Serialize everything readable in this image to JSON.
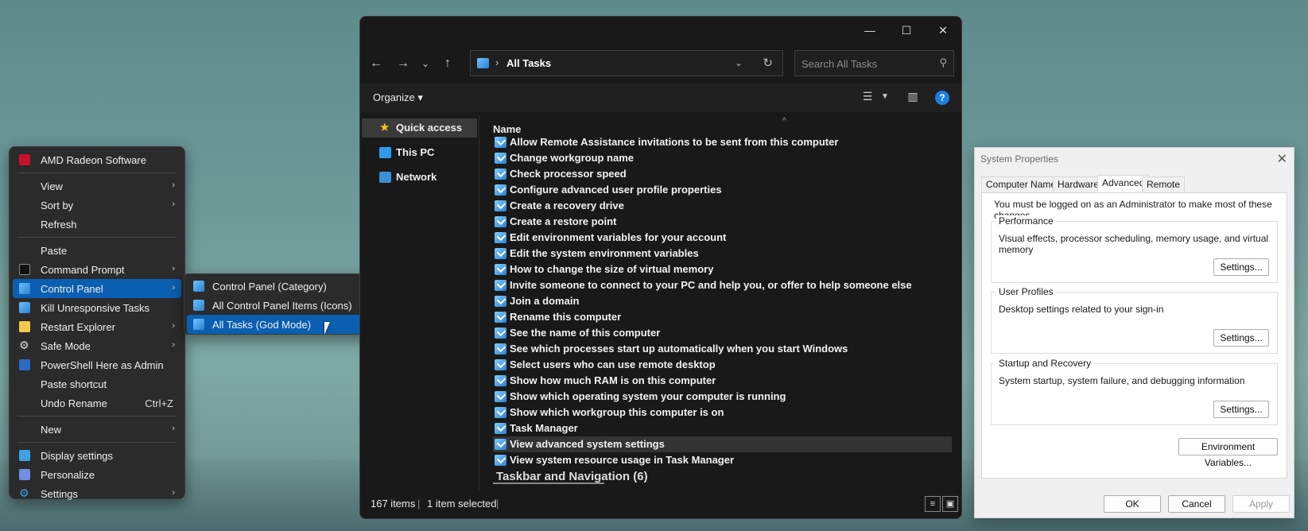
{
  "context_menu": {
    "items": [
      {
        "label": "AMD Radeon Software",
        "icon": "amd-radeon-icon"
      },
      {
        "label": "View",
        "submenu": true
      },
      {
        "label": "Sort by",
        "submenu": true
      },
      {
        "label": "Refresh"
      },
      {
        "label": "Paste"
      },
      {
        "label": "Command Prompt",
        "submenu": true,
        "icon": "command-prompt-icon"
      },
      {
        "label": "Control Panel",
        "submenu": true,
        "icon": "control-panel-icon"
      },
      {
        "label": "Kill Unresponsive Tasks",
        "icon": "kill-tasks-icon"
      },
      {
        "label": "Restart Explorer",
        "submenu": true,
        "icon": "folder-icon"
      },
      {
        "label": "Safe Mode",
        "submenu": true,
        "icon": "gear-icon"
      },
      {
        "label": "PowerShell Here as Admin",
        "icon": "powershell-icon"
      },
      {
        "label": "Paste shortcut"
      },
      {
        "label": "Undo Rename",
        "accelerator": "Ctrl+Z"
      },
      {
        "label": "New",
        "submenu": true
      },
      {
        "label": "Display settings",
        "icon": "display-icon"
      },
      {
        "label": "Personalize",
        "icon": "personalize-icon"
      },
      {
        "label": "Settings",
        "submenu": true,
        "icon": "settings-gear-icon"
      }
    ],
    "submenu": [
      {
        "label": "Control Panel (Category)"
      },
      {
        "label": "All Control Panel Items (Icons)"
      },
      {
        "label": "All Tasks (God Mode)"
      }
    ]
  },
  "explorer": {
    "address": {
      "separator": "›",
      "location": "All Tasks"
    },
    "search": {
      "placeholder": "Search All Tasks"
    },
    "toolbar": {
      "organize_label": "Organize ▾"
    },
    "nav": [
      {
        "label": "Quick access",
        "icon": "star-icon"
      },
      {
        "label": "This PC",
        "icon": "monitor-icon"
      },
      {
        "label": "Network",
        "icon": "network-icon"
      }
    ],
    "column_header": "Name",
    "files": [
      "Allow Remote Assistance invitations to be sent from this computer",
      "Change workgroup name",
      "Check processor speed",
      "Configure advanced user profile properties",
      "Create a recovery drive",
      "Create a restore point",
      "Edit environment variables for your account",
      "Edit the system environment variables",
      "How to change the size of virtual memory",
      "Invite someone to connect to your PC and help you, or offer to help someone else",
      "Join a domain",
      "Rename this computer",
      "See the name of this computer",
      "See which processes start up automatically when you start Windows",
      "Select users who can use remote desktop",
      "Show how much RAM is on this computer",
      "Show which operating system your computer is running",
      "Show which workgroup this computer is on",
      "Task Manager",
      "View advanced system settings",
      "View system resource usage in Task Manager"
    ],
    "group_header_partial": "Taskbar and Navigation (6)",
    "status": {
      "item_count": "167 items",
      "selected": "1 item selected"
    }
  },
  "system_properties": {
    "title": "System Properties",
    "tabs": [
      "Computer Name",
      "Hardware",
      "Advanced",
      "Remote"
    ],
    "active_tab": "Advanced",
    "admin_note": "You must be logged on as an Administrator to make most of these changes.",
    "groups": [
      {
        "title": "Performance",
        "desc": "Visual effects, processor scheduling, memory usage, and virtual memory",
        "button": "Settings..."
      },
      {
        "title": "User Profiles",
        "desc": "Desktop settings related to your sign-in",
        "button": "Settings..."
      },
      {
        "title": "Startup and Recovery",
        "desc": "System startup, system failure, and debugging information",
        "button": "Settings..."
      }
    ],
    "env_button": "Environment Variables...",
    "ok": "OK",
    "cancel": "Cancel",
    "apply": "Apply"
  }
}
